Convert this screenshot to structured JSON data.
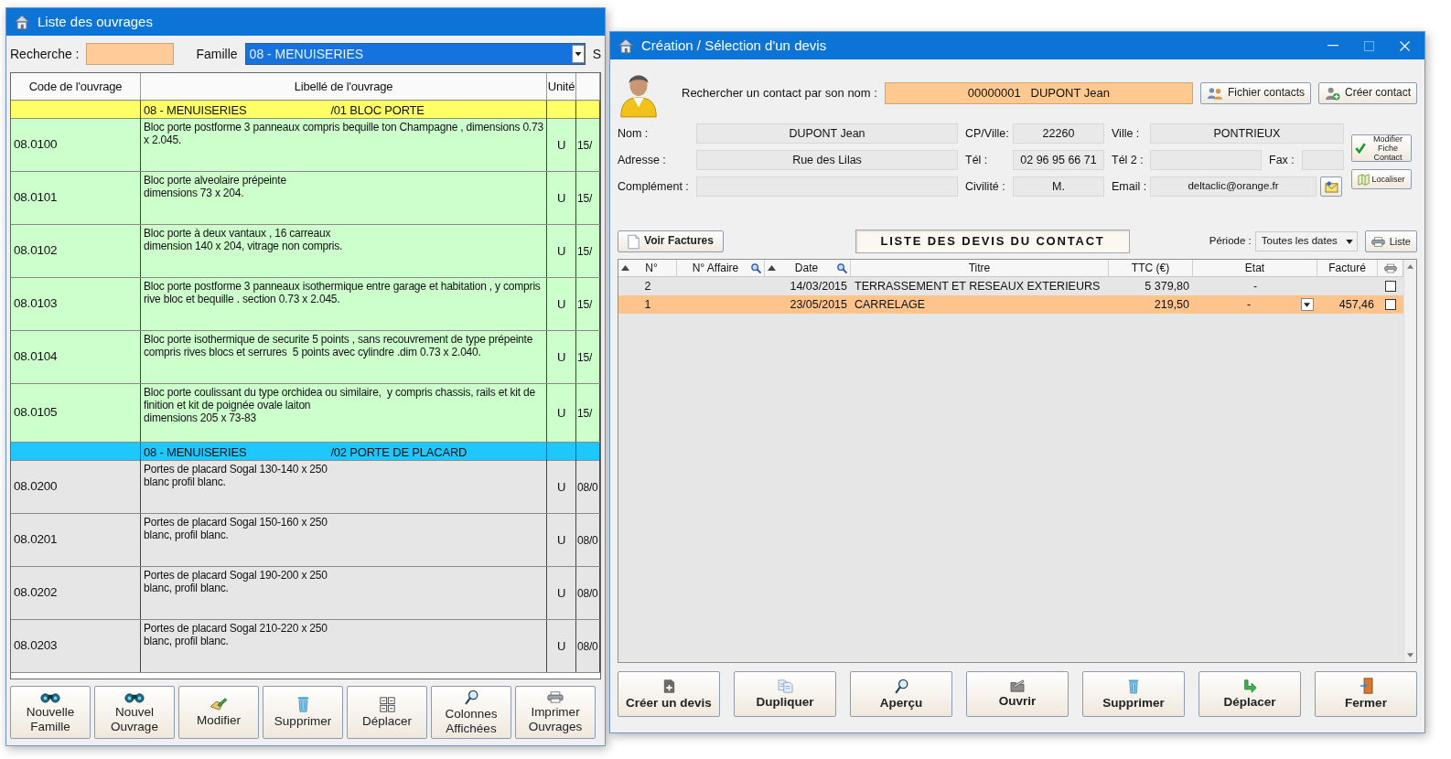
{
  "left_window": {
    "title": "Liste des ouvrages",
    "search": {
      "label": "Recherche :"
    },
    "family": {
      "label": "Famille",
      "value": "08 - MENUISERIES"
    },
    "cut_label": "S",
    "table": {
      "columns": [
        "Code de l'ouvrage",
        "Libellé de l'ouvrage",
        "Unité"
      ],
      "groups": [
        {
          "family": "08 - MENUISERIES",
          "subfamily": "/01 BLOC PORTE",
          "color": "#ffff66",
          "rows": [
            {
              "code": "08.0100",
              "label": "Bloc porte postforme 3 panneaux compris bequille ton Champagne , dimensions 0.73 x 2.045.",
              "unit": "U",
              "column_4": "15/",
              "color": "#ccffcc"
            },
            {
              "code": "08.0101",
              "label": "Bloc porte alveolaire prépeinte\ndimensions 73 x 204.",
              "unit": "U",
              "column_4": "15/",
              "color": "#ccffcc"
            },
            {
              "code": "08.0102",
              "label": "Bloc porte à deux vantaux , 16 carreaux\ndimension 140 x 204, vitrage non compris.",
              "unit": "U",
              "column_4": "15/",
              "color": "#ccffcc"
            },
            {
              "code": "08.0103",
              "label": "Bloc porte postforme 3 panneaux isothermique entre garage et habitation , y compris rive bloc et bequille . section 0.73 x 2.045.",
              "unit": "U",
              "column_4": "15/",
              "color": "#ccffcc"
            },
            {
              "code": "08.0104",
              "label": "Bloc porte isothermique de securite 5 points , sans recouvrement de type prépeinte compris rives blocs et serrures  5 points avec cylindre .dim 0.73 x 2.040.",
              "unit": "U",
              "column_4": "15/",
              "color": "#ccffcc"
            },
            {
              "code": "08.0105",
              "label": "Bloc porte coulissant du type orchidea ou similaire,  y compris chassis, rails et kit de finition et kit de poignée ovale laiton\ndimensions 205 x 73-83",
              "unit": "U",
              "column_4": "15/",
              "color": "#ccffcc"
            }
          ]
        },
        {
          "family": "08 - MENUISERIES",
          "subfamily": "/02 PORTE DE PLACARD",
          "color": "#1ec8ff",
          "rows": [
            {
              "code": "08.0200",
              "label": "Portes de placard Sogal 130-140 x 250\nblanc profil blanc.",
              "unit": "U",
              "column_4": "08/0",
              "color": "#e6e6e6"
            },
            {
              "code": "08.0201",
              "label": "Portes de placard Sogal 150-160 x 250\nblanc, profil blanc.",
              "unit": "U",
              "column_4": "08/0",
              "color": "#e6e6e6"
            },
            {
              "code": "08.0202",
              "label": "Portes de placard Sogal 190-200 x 250\nblanc, profil blanc.",
              "unit": "U",
              "column_4": "08/0",
              "color": "#e6e6e6"
            },
            {
              "code": "08.0203",
              "label": "Portes de placard Sogal 210-220 x 250\nblanc, profil blanc.",
              "unit": "U",
              "column_4": "08/0",
              "color": "#e6e6e6"
            }
          ]
        }
      ]
    },
    "buttons": [
      "Nouvelle\nFamille",
      "Nouvel\nOuvrage",
      "Modifier",
      "Supprimer",
      "Déplacer",
      "Colonnes\nAffichées",
      "Imprimer\nOuvrages"
    ]
  },
  "right_window": {
    "title": "Création / Sélection d'un devis",
    "window_controls": [
      {
        "kind": "minimize",
        "disabled": false
      },
      {
        "kind": "maximize",
        "disabled": true
      },
      {
        "kind": "close",
        "disabled": false
      }
    ],
    "search": {
      "label": "Rechercher un contact par son nom :",
      "value": "00000001   DUPONT Jean"
    },
    "contact_buttons": [
      "Fichier contacts",
      "Créer contact"
    ],
    "fields_left": [
      {
        "label": "Nom :",
        "value": "DUPONT Jean"
      },
      {
        "label": "Adresse :",
        "value": "Rue des Lilas"
      },
      {
        "label": "Complément :"
      }
    ],
    "fields_middle": [
      {
        "label": "CP/Ville:",
        "value": "22260"
      },
      {
        "label": "Tél :",
        "value": "02 96 95 66 71"
      },
      {
        "label": "Civilité :",
        "value": "M."
      }
    ],
    "city": {
      "label": "Ville :",
      "value": "PONTRIEUX"
    },
    "phone_2": {
      "label": "Tél 2 :"
    },
    "fax": {
      "label": "Fax :"
    },
    "email": {
      "label": "Email :",
      "value": "deltaclic@orange.fr"
    },
    "side_buttons": [
      "Modifier\nFiche Contact",
      "Localiser"
    ],
    "invoices_button": "Voir Factures",
    "list_title": "LISTE DES DEVIS DU CONTACT",
    "period": {
      "label": "Période :",
      "value": "Toutes les dates"
    },
    "list_button": "Liste",
    "table": {
      "columns": [
        {
          "label": "N°",
          "sorted": true,
          "search": false
        },
        {
          "label": "N° Affaire",
          "sorted": false,
          "search": true
        },
        {
          "label": "Date",
          "sorted": true,
          "search": true
        },
        {
          "label": "Titre",
          "sorted": false,
          "search": false
        },
        {
          "label": "TTC (€)",
          "sorted": false,
          "search": false
        },
        {
          "label": "Etat",
          "sorted": false,
          "search": false
        },
        {
          "label": "Facturé",
          "sorted": false,
          "search": false
        }
      ],
      "rows": [
        {
          "number": "2",
          "date": "14/03/2015",
          "title": "TERRASSEMENT ET RESEAUX EXTERIEURS",
          "ttc": "5 379,80",
          "status": "-",
          "checked": false,
          "selected": false
        },
        {
          "number": "1",
          "date": "23/05/2015",
          "title": "CARRELAGE",
          "ttc": "219,50",
          "status": "-",
          "invoiced": "457,46",
          "checked": false,
          "selected": true
        }
      ]
    },
    "buttons": [
      "Créer un devis",
      "Dupliquer",
      "Aperçu",
      "Ouvrir",
      "Supprimer",
      "Déplacer",
      "Fermer"
    ]
  }
}
